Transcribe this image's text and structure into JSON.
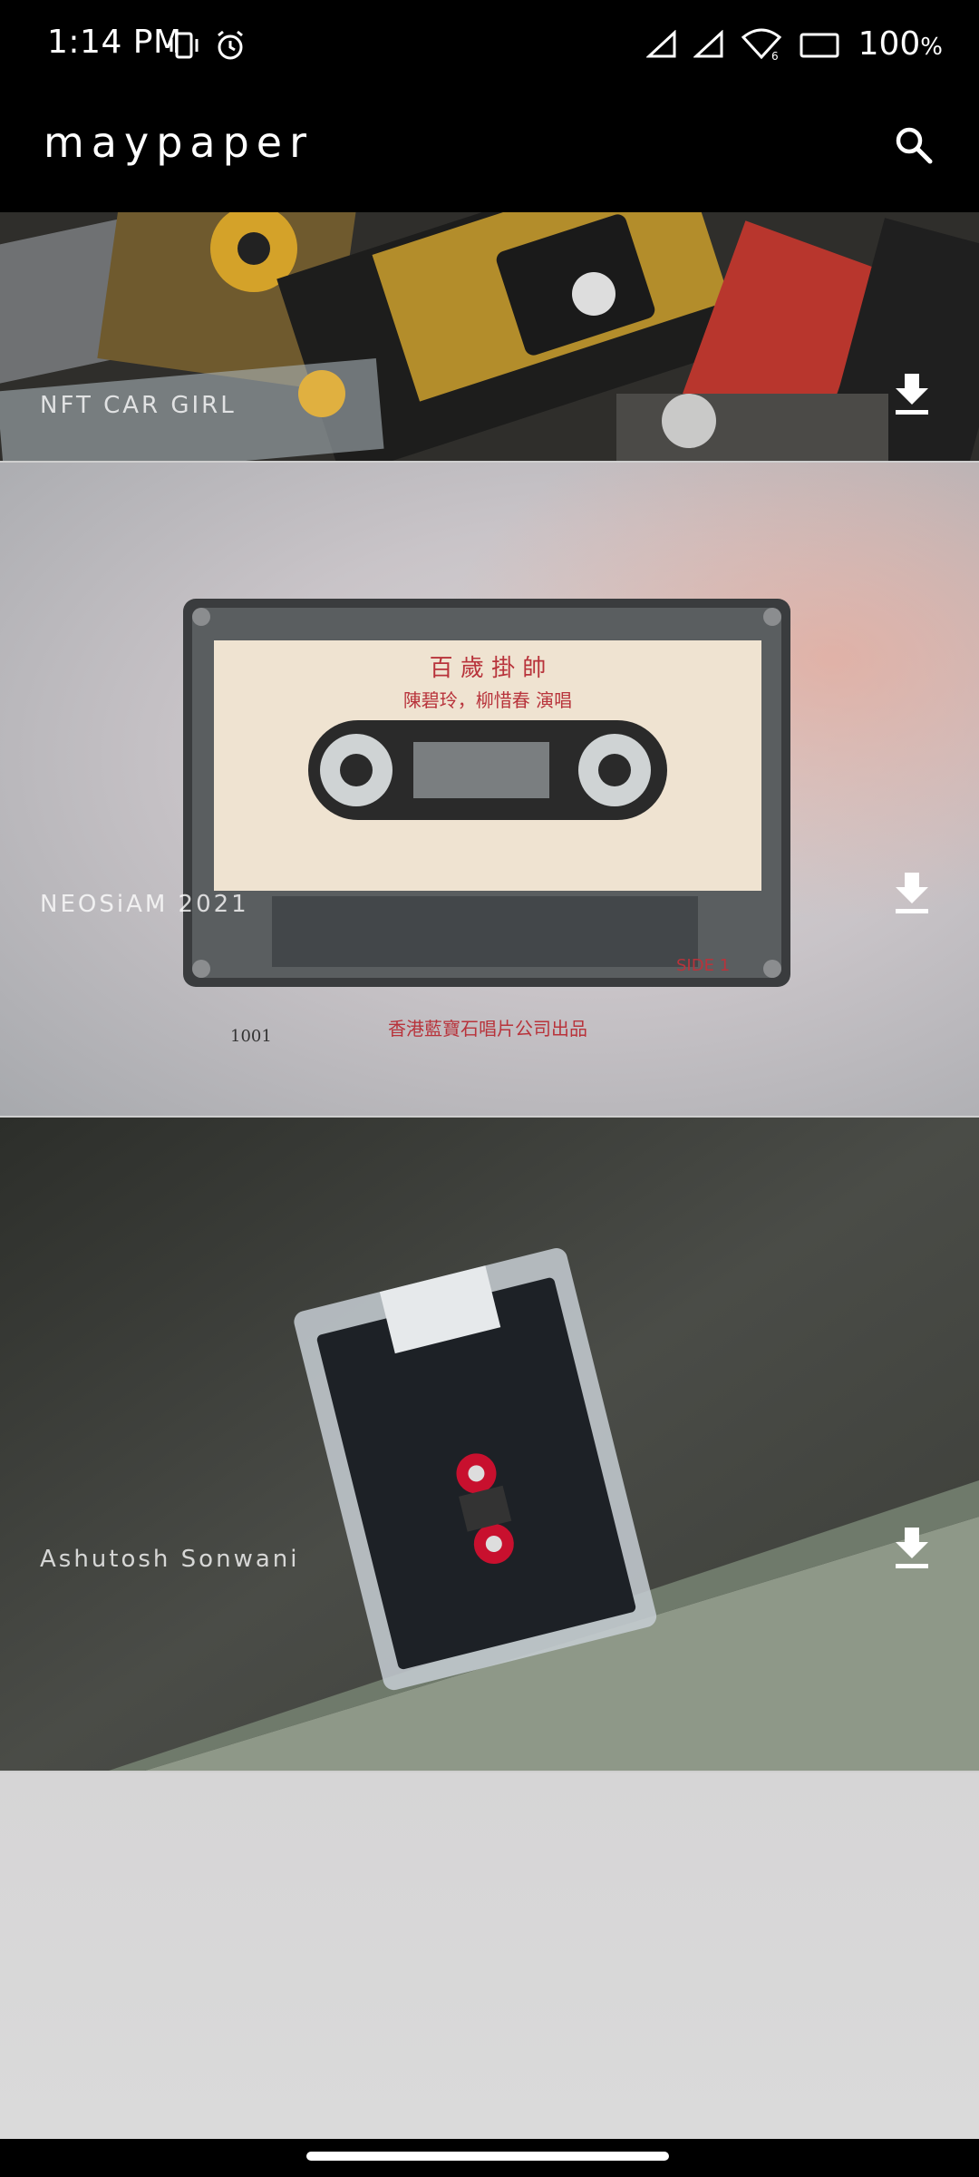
{
  "status_bar": {
    "time": "1:14 PM",
    "battery": "100",
    "battery_unit": "%",
    "icons": [
      "vibrate-icon",
      "alarm-icon",
      "signal-icon",
      "signal-icon",
      "wifi-icon",
      "battery-icon"
    ]
  },
  "app_bar": {
    "title": "maypaper",
    "search_icon": "search-icon"
  },
  "wallpapers": [
    {
      "credit": "NFT CAR GIRL",
      "action_icon": "download-icon"
    },
    {
      "credit": "NEOSiAM  2021",
      "action_icon": "download-icon"
    },
    {
      "credit": "Ashutosh Sonwani",
      "action_icon": "download-icon"
    }
  ],
  "cassette_label": {
    "line1": "百 歲 掛 帥",
    "line2": "陳碧玲，柳惜春 演唱",
    "side": "SIDE 1",
    "number": "1001",
    "footer": "香港藍寶石唱片公司出品"
  },
  "colors": {
    "background": "#000000",
    "placeholder": "#d8d8d8"
  }
}
